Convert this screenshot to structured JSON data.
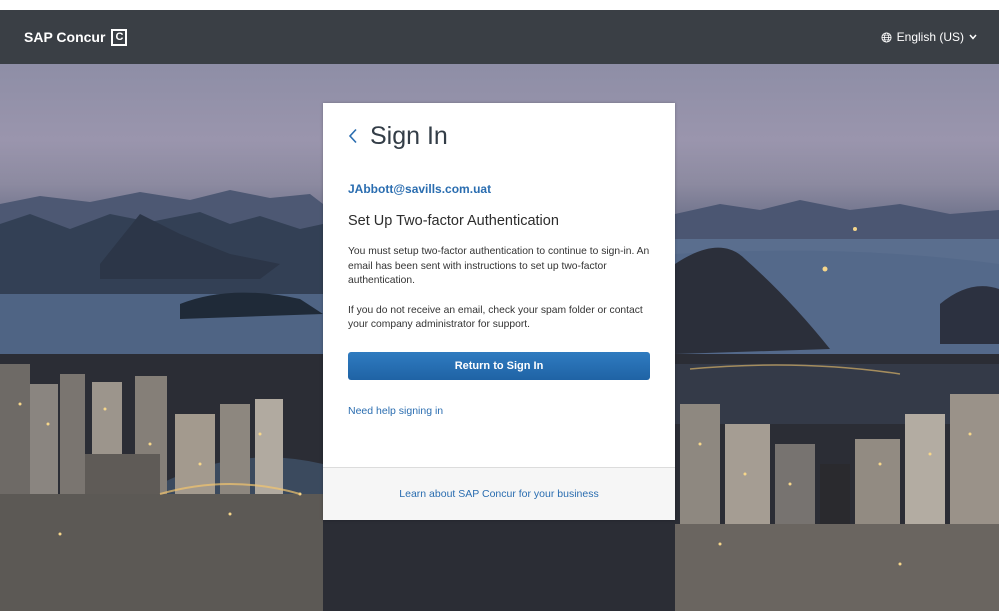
{
  "header": {
    "brand": "SAP Concur",
    "brand_mark": "C",
    "language": "English (US)"
  },
  "card": {
    "title": "Sign In",
    "email": "JAbbott@savills.com.uat",
    "subtitle": "Set Up Two-factor Authentication",
    "message": "You must setup two-factor authentication to continue to sign-in. An email has been sent with instructions to set up two-factor authentication.",
    "message2": "If you do not receive an email, check your spam folder or contact your company administrator for support.",
    "return_button": "Return to Sign In",
    "help_link": "Need help signing in",
    "footer_link": "Learn about SAP Concur for your business"
  },
  "icons": {
    "back": "chevron-left-icon",
    "globe": "globe-icon",
    "caret": "chevron-down-icon"
  },
  "colors": {
    "header_bg": "#3a3f45",
    "link": "#2a6db0",
    "button": "#2a70b5"
  }
}
